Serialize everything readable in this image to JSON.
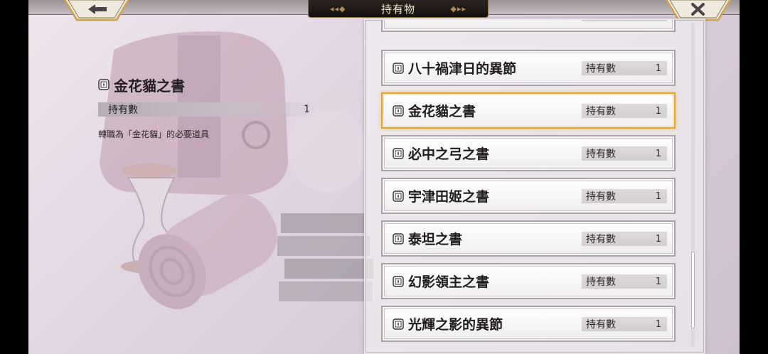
{
  "header": {
    "title": "持有物"
  },
  "detail": {
    "item_name": "金花貓之書",
    "count_label": "持有數",
    "count_value": "1",
    "description": "轉職為「金花貓」的必要道具"
  },
  "list": {
    "qty_label": "持有數",
    "items": [
      {
        "name": "",
        "count": ""
      },
      {
        "name": "八十禍津日的異節",
        "count": "1"
      },
      {
        "name": "金花貓之書",
        "count": "1",
        "selected": true
      },
      {
        "name": "必中之弓之書",
        "count": "1"
      },
      {
        "name": "宇津田姬之書",
        "count": "1"
      },
      {
        "name": "泰坦之書",
        "count": "1"
      },
      {
        "name": "幻影領主之書",
        "count": "1"
      },
      {
        "name": "光輝之影的異節",
        "count": "1"
      }
    ]
  },
  "icons": {
    "back": "left-arrow-icon",
    "close": "x-close-icon",
    "item": "book-icon"
  },
  "colors": {
    "selected_border": "#e0a53a",
    "title_plate": "#1c1714",
    "title_text": "#f2e6cf"
  }
}
